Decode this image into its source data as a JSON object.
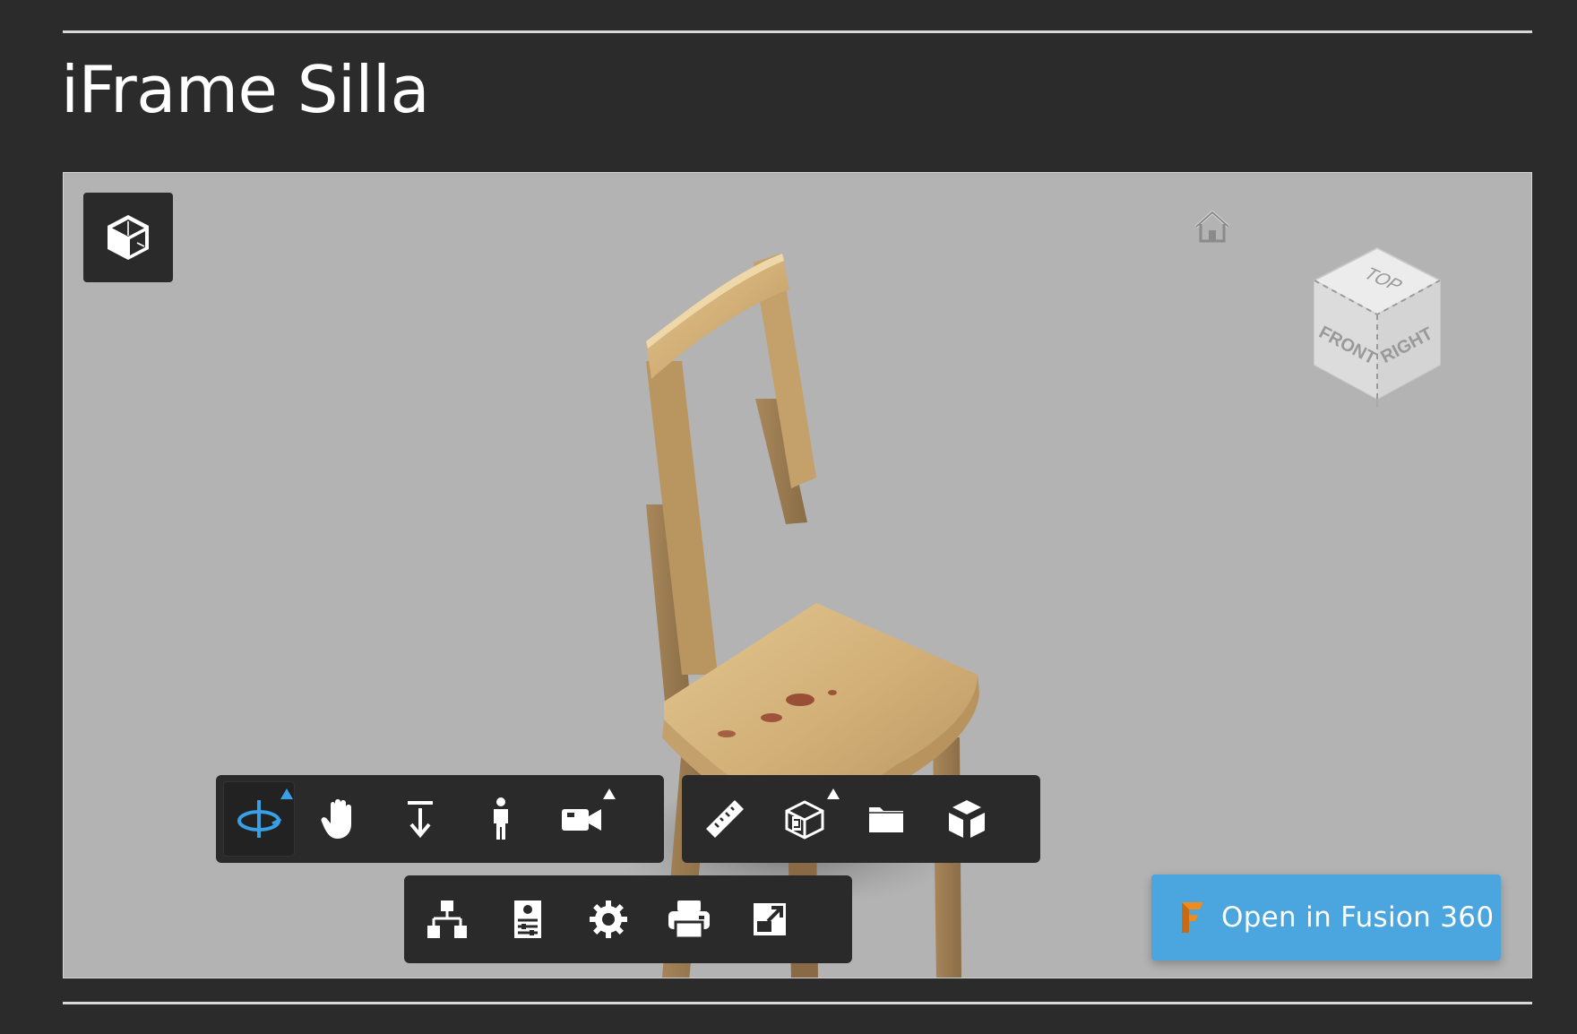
{
  "page": {
    "title": "iFrame Silla"
  },
  "viewer": {
    "viewcube": {
      "top": "TOP",
      "front": "FRONT",
      "right": "RIGHT"
    },
    "open_button": {
      "label": "Open in Fusion 360"
    }
  },
  "toolbars": {
    "navigation": [
      "orbit-icon",
      "pan-icon",
      "zoom-icon",
      "first-person-icon",
      "camera-icon"
    ],
    "tools": [
      "measure-icon",
      "section-analysis-icon",
      "model-browser-icon",
      "explode-icon"
    ],
    "settings": [
      "structure-icon",
      "properties-icon",
      "settings-icon",
      "print-icon",
      "fullscreen-icon"
    ]
  },
  "colors": {
    "background": "#2b2b2b",
    "viewport": "#b3b3b3",
    "toolbar": "#2a2a2a",
    "accent": "#4ba6e0",
    "active_icon": "#3aa0e6"
  }
}
